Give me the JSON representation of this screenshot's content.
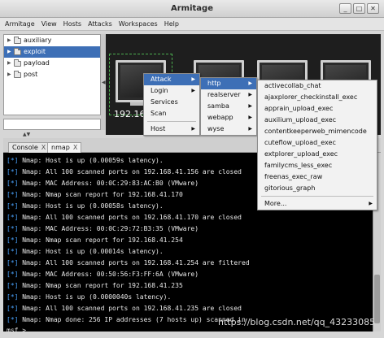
{
  "window": {
    "title": "Armitage"
  },
  "window_buttons": [
    "_",
    "□",
    "✕"
  ],
  "menubar": [
    "Armitage",
    "View",
    "Hosts",
    "Attacks",
    "Workspaces",
    "Help"
  ],
  "tree": [
    {
      "label": "auxiliary",
      "selected": false
    },
    {
      "label": "exploit",
      "selected": true
    },
    {
      "label": "payload",
      "selected": false
    },
    {
      "label": "post",
      "selected": false
    }
  ],
  "targets": {
    "host_label": "192.16"
  },
  "host_menu": {
    "items": [
      {
        "label": "Attack",
        "has_submenu": true,
        "active": true
      },
      {
        "label": "Login",
        "has_submenu": true,
        "active": false
      },
      {
        "label": "Services",
        "has_submenu": false,
        "active": false
      },
      {
        "label": "Scan",
        "has_submenu": false,
        "active": false
      },
      {
        "label": "Host",
        "has_submenu": true,
        "active": false
      }
    ]
  },
  "attack_menu": {
    "items": [
      {
        "label": "http",
        "has_submenu": true,
        "active": true
      },
      {
        "label": "realserver",
        "has_submenu": true,
        "active": false
      },
      {
        "label": "samba",
        "has_submenu": true,
        "active": false
      },
      {
        "label": "webapp",
        "has_submenu": true,
        "active": false
      },
      {
        "label": "wyse",
        "has_submenu": true,
        "active": false
      }
    ]
  },
  "http_menu": {
    "items": [
      "activecollab_chat",
      "ajaxplorer_checkinstall_exec",
      "apprain_upload_exec",
      "auxilium_upload_exec",
      "contentkeeperweb_mimencode",
      "cuteflow_upload_exec",
      "extplorer_upload_exec",
      "familycms_less_exec",
      "freenas_exec_raw",
      "gitorious_graph"
    ],
    "more_label": "More..."
  },
  "tabs": [
    {
      "label": "Console",
      "close": "X",
      "active": false
    },
    {
      "label": "nmap",
      "close": "X",
      "active": true
    }
  ],
  "console": {
    "prefix": "[*]",
    "lines": [
      "Nmap: Host is up (0.00059s latency).",
      "Nmap: All 100 scanned ports on 192.168.41.156 are closed",
      "Nmap: MAC Address: 00:0C:29:83:AC:B0 (VMware)",
      "Nmap: Nmap scan report for 192.168.41.170",
      "Nmap: Host is up (0.00058s latency).",
      "Nmap: All 100 scanned ports on 192.168.41.170 are closed",
      "Nmap: MAC Address: 00:0C:29:72:B3:35 (VMware)",
      "Nmap: Nmap scan report for 192.168.41.254",
      "Nmap: Host is up (0.00014s latency).",
      "Nmap: All 100 scanned ports on 192.168.41.254 are filtered",
      "Nmap: MAC Address: 00:50:56:F3:FF:6A (VMware)",
      "Nmap: Nmap scan report for 192.168.41.235",
      "Nmap: Host is up (0.0000040s latency).",
      "Nmap: All 100 scanned ports on 192.168.41.235 are closed",
      "Nmap: Nmap done: 256 IP addresses (7 hosts up) scanned in"
    ],
    "prompt": "msf >"
  },
  "watermark": "https://blog.csdn.net/qq_43233085",
  "colors": {
    "selection": "#3d6fb6",
    "console_bg": "#000000",
    "prefix": "#4aa3ff",
    "graph_bg": "#1e1e1e"
  }
}
